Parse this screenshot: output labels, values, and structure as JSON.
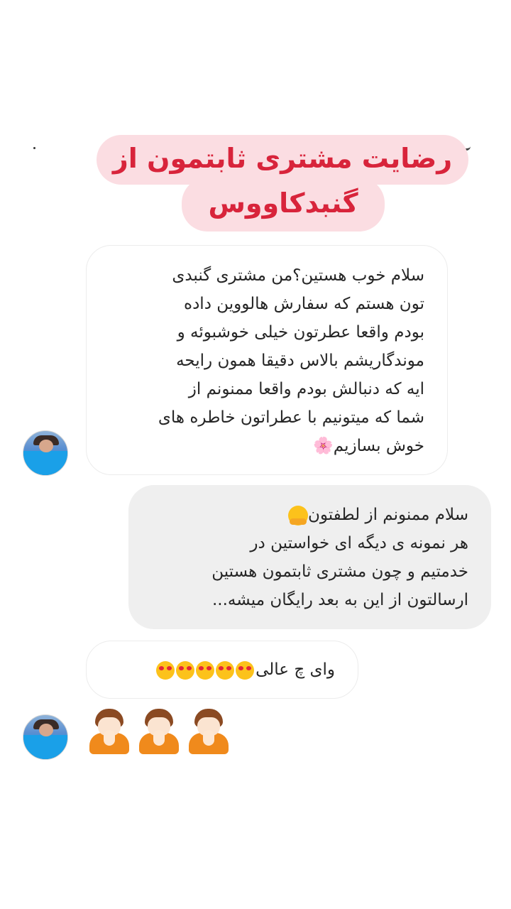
{
  "header": {
    "title_line1": "رضایت مشتری ثابتمون از",
    "title_line2": "گنبدکاووس"
  },
  "messages": [
    {
      "sender": "customer",
      "lines": [
        "سلام خوب هستین؟من مشتری گنبدی",
        "تون هستم که سفارش هالووین داده",
        "بودم واقعا عطرتون خیلی خوشبوئه و",
        "موندگاریشم بالاس دقیقا همون رایحه",
        "ایه که دنبالش بودم واقعا ممنونم از",
        "شما که میتونیم با عطراتون خاطره های",
        "خوش بسازیم🌸"
      ]
    },
    {
      "sender": "shop",
      "lines": [
        "سلام ممنونم از لطفتون",
        "هر نمونه ی دیگه ای خواستین در",
        "خدمتیم و چون مشتری ثابتمون هستین",
        "ارسالتون از این به بعد رایگان میشه..."
      ],
      "emoji": "hugging-face-icon"
    },
    {
      "sender": "customer",
      "text": "وای چ عالی",
      "emoji_count": 5,
      "emoji": "heart-eyes-face-icon"
    },
    {
      "sender": "customer",
      "emoji": "person-bowing-icon",
      "emoji_count": 3
    }
  ],
  "colors": {
    "title_bg": "#fbdde2",
    "title_text": "#d8243b",
    "outgoing_bubble": "#efefef",
    "incoming_border": "#ececec"
  }
}
